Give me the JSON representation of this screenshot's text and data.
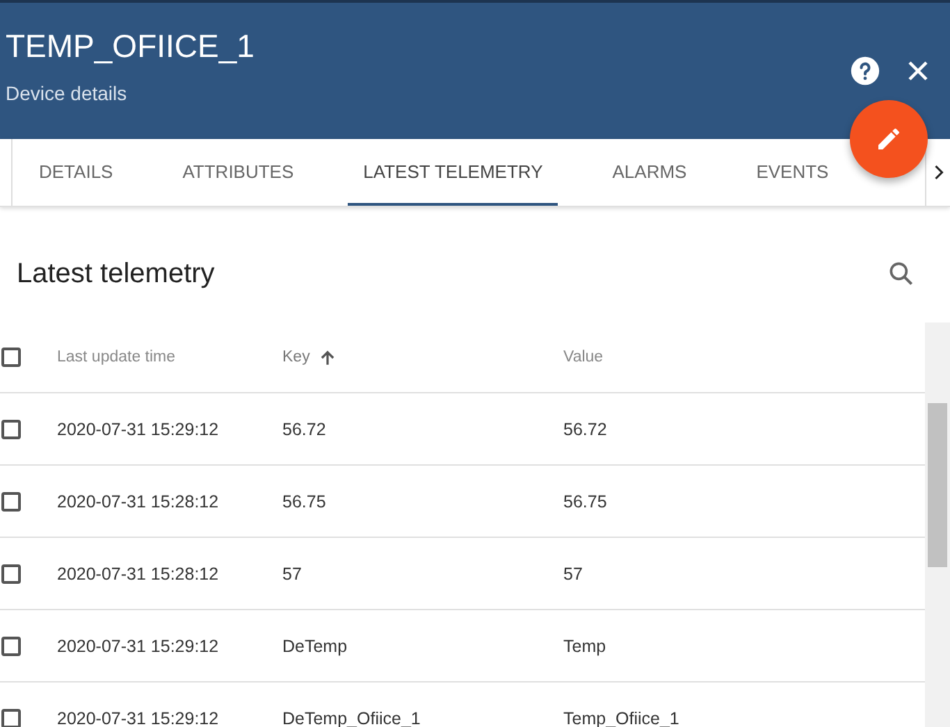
{
  "header": {
    "title": "TEMP_OFIICE_1",
    "subtitle": "Device details"
  },
  "tabs": [
    {
      "label": "DETAILS",
      "selected": false
    },
    {
      "label": "ATTRIBUTES",
      "selected": false
    },
    {
      "label": "LATEST TELEMETRY",
      "selected": true
    },
    {
      "label": "ALARMS",
      "selected": false
    },
    {
      "label": "EVENTS",
      "selected": false
    }
  ],
  "panel": {
    "title": "Latest telemetry"
  },
  "table": {
    "all_checked": false,
    "columns": [
      {
        "label": "Last update time",
        "sorted": false
      },
      {
        "label": "Key",
        "sorted": true
      },
      {
        "label": "Value",
        "sorted": false
      }
    ],
    "rows": [
      {
        "checked": false,
        "cells": [
          "2020-07-31 15:29:12",
          "56.72",
          "56.72"
        ]
      },
      {
        "checked": false,
        "cells": [
          "2020-07-31 15:28:12",
          "56.75",
          "56.75"
        ]
      },
      {
        "checked": false,
        "cells": [
          "2020-07-31 15:28:12",
          "57",
          "57"
        ]
      },
      {
        "checked": false,
        "cells": [
          "2020-07-31 15:29:12",
          "DeTemp",
          "Temp"
        ]
      },
      {
        "checked": false,
        "cells": [
          "2020-07-31 15:29:12",
          "DeTemp_Ofiice_1",
          "Temp_Ofiice_1"
        ]
      }
    ]
  }
}
